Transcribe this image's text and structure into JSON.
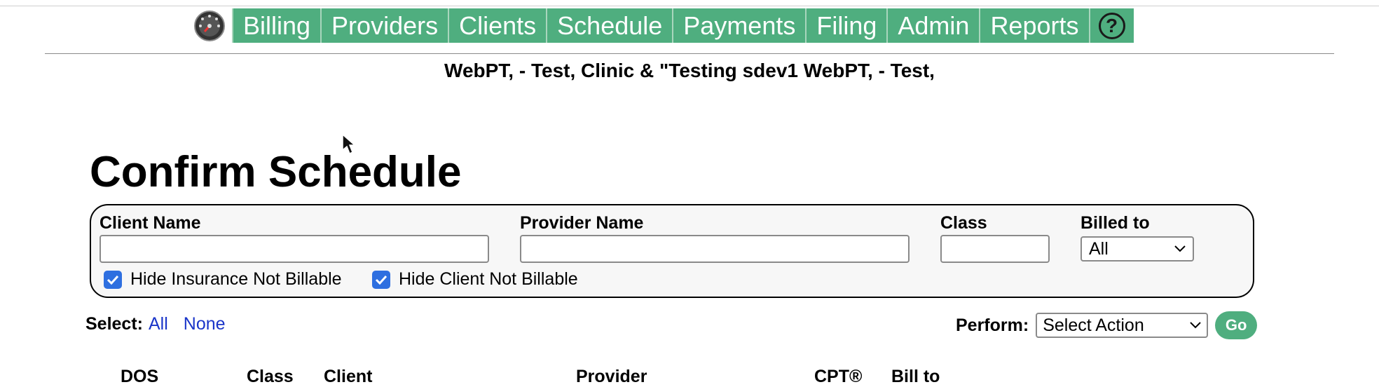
{
  "nav": {
    "logo_icon": "dashboard-gauge-icon",
    "items": [
      "Billing",
      "Providers",
      "Clients",
      "Schedule",
      "Payments",
      "Filing",
      "Admin",
      "Reports"
    ],
    "help_icon": "help-circle-icon",
    "help_glyph": "?",
    "accent": "#4fae7f"
  },
  "clinic_line": "WebPT, - Test, Clinic & \"Testing sdev1 WebPT, - Test,",
  "page_title": "Confirm Schedule",
  "filters": {
    "client_name_label": "Client Name",
    "client_name_value": "",
    "provider_name_label": "Provider Name",
    "provider_name_value": "",
    "class_label": "Class",
    "class_value": "",
    "billed_to_label": "Billed to",
    "billed_to_value": "All",
    "hide_insurance_label": "Hide Insurance Not Billable",
    "hide_insurance_checked": true,
    "hide_client_label": "Hide Client Not Billable",
    "hide_client_checked": true
  },
  "select_controls": {
    "label": "Select:",
    "all": "All",
    "none": "None"
  },
  "perform": {
    "label": "Perform:",
    "action_value": "Select Action",
    "go_label": "Go"
  },
  "table": {
    "headers": [
      "DOS",
      "Class",
      "Client",
      "Provider",
      "CPT®",
      "Bill to"
    ]
  }
}
